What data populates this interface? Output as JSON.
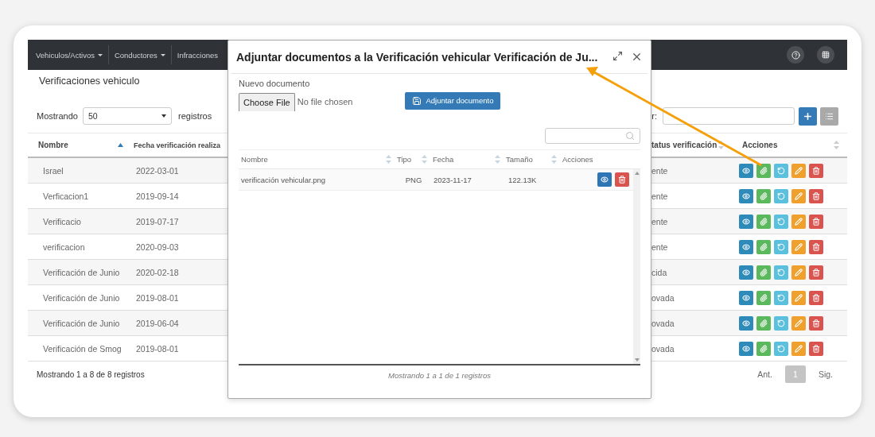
{
  "navbar": {
    "items": [
      {
        "label": "Vehiculos/Activos",
        "dropdown": true
      },
      {
        "label": "Conductores",
        "dropdown": true
      },
      {
        "label": "Infracciones",
        "dropdown": false
      }
    ]
  },
  "page_title": "Verificaciones vehiculo",
  "length_control": {
    "prefix": "Mostrando",
    "value": "50",
    "suffix": "registros"
  },
  "search": {
    "label": "r:"
  },
  "table": {
    "columns": [
      {
        "label": "Nombre",
        "sorted_ascending": true
      },
      {
        "label": "Fecha verificación realiza"
      },
      {
        "label": "tatus verificación",
        "sorted_ascending": false
      },
      {
        "label": "Acciones",
        "sorted_ascending": false
      }
    ],
    "rows": [
      {
        "name": "Israel",
        "date": "2022-03-01",
        "status": "ente"
      },
      {
        "name": "Verficacion1",
        "date": "2019-09-14",
        "status": "ente"
      },
      {
        "name": "Verificacio",
        "date": "2019-07-17",
        "status": "ente"
      },
      {
        "name": "verificacion",
        "date": "2020-09-03",
        "status": "ente"
      },
      {
        "name": "Verificación de Junio",
        "date": "2020-02-18",
        "status": "cida"
      },
      {
        "name": "Verificación de Junio",
        "date": "2019-08-01",
        "status": "ovada"
      },
      {
        "name": "Verificación de Junio",
        "date": "2019-06-04",
        "status": "ovada"
      },
      {
        "name": "Verificación de Smog",
        "date": "2019-08-01",
        "status": "ovada"
      }
    ]
  },
  "info": "Mostrando 1 a 8 de 8 registros",
  "pagination": {
    "prev": "Ant.",
    "pages": [
      {
        "label": "1",
        "selected": true
      }
    ],
    "next": "Sig."
  },
  "modal": {
    "title": "Adjuntar documentos a la Verificación vehicular Verificación de Ju...",
    "field_label": "Nuevo documento",
    "file_button": "Choose File",
    "file_status": "No file chosen",
    "attach_button": "Adjuntar documento",
    "columns": [
      {
        "label": "Nombre",
        "sorted_ascending": false
      },
      {
        "label": "Tipo",
        "sorted_ascending": false
      },
      {
        "label": "Fecha",
        "sorted_ascending": false
      },
      {
        "label": "Tamaño",
        "sorted_ascending": false
      },
      {
        "label": "Acciones"
      }
    ],
    "rows": [
      {
        "name": "verificación vehicular.png",
        "type": "PNG",
        "date": "2023-11-17",
        "size": "122.13K"
      }
    ],
    "info": "Mostrando 1 a 1 de 1 registros"
  }
}
